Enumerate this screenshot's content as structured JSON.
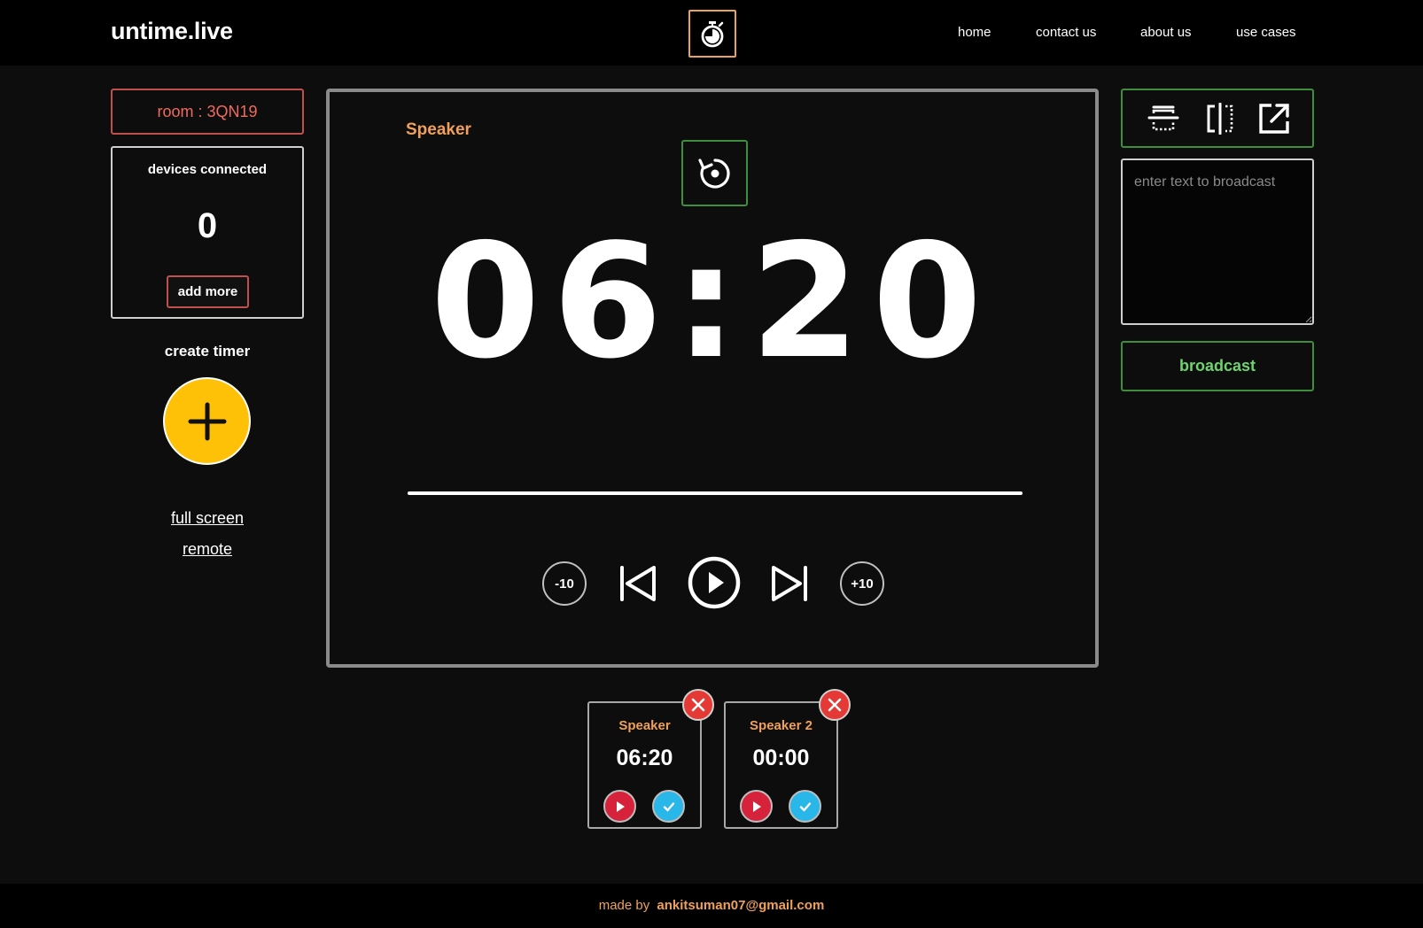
{
  "header": {
    "brand": "untime.live",
    "nav": {
      "home": "home",
      "contact": "contact us",
      "about": "about us",
      "use_cases": "use cases"
    },
    "logo_icon": "stopwatch-icon"
  },
  "sidebar": {
    "room_label": "room : 3QN19",
    "devices_title": "devices connected",
    "devices_count": "0",
    "add_more_label": "add more",
    "create_timer_label": "create timer",
    "full_screen_link": "full screen",
    "remote_link": "remote"
  },
  "timer": {
    "speaker_name": "Speaker",
    "display_time": "06:20",
    "progress_fraction": 1.0,
    "minus_label": "-10",
    "plus_label": "+10"
  },
  "right_panel": {
    "broadcast_placeholder": "enter text to broadcast",
    "broadcast_value": "",
    "broadcast_button": "broadcast",
    "view_icons": [
      "top-bar-layout-icon",
      "split-view-icon",
      "open-external-icon"
    ]
  },
  "timer_cards": [
    {
      "name": "Speaker",
      "time": "06:20"
    },
    {
      "name": "Speaker 2",
      "time": "00:00"
    }
  ],
  "footer": {
    "prefix": "made by",
    "email": "ankitsuman07@gmail.com"
  },
  "colors": {
    "accent_orange": "#f0a05a",
    "room_red": "#f06a5e",
    "create_yellow": "#ffc107",
    "broadcast_green": "#6fd36f",
    "border_green": "#3e8e3e",
    "close_red": "#e53935",
    "play_red": "#d6223a",
    "check_blue": "#29b6e8"
  }
}
